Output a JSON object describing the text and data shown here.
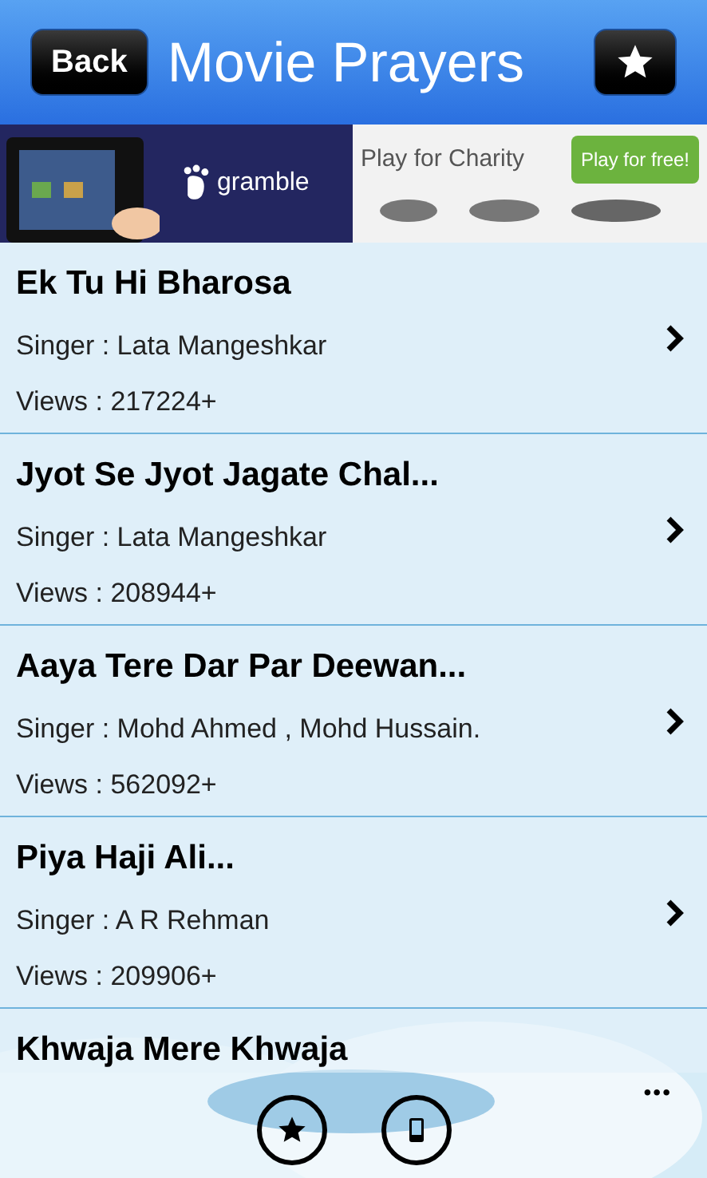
{
  "header": {
    "back_button": "Back",
    "title": "Movie Prayers"
  },
  "ad": {
    "brand": "gramble",
    "headline": "Play for Charity",
    "cta": "Play for free!"
  },
  "songs": [
    {
      "title": "Ek Tu Hi Bharosa",
      "singer": "Singer : Lata Mangeshkar",
      "views": "Views : 217224+"
    },
    {
      "title": "Jyot Se Jyot Jagate Chal...",
      "singer": "Singer : Lata Mangeshkar",
      "views": "Views : 208944+"
    },
    {
      "title": "Aaya Tere Dar Par Deewan...",
      "singer": "Singer : Mohd Ahmed , Mohd Hussain.",
      "views": "Views : 562092+"
    },
    {
      "title": "Piya Haji Ali...",
      "singer": "Singer : A R Rehman",
      "views": "Views : 209906+"
    },
    {
      "title": "Khwaja Mere Khwaja"
    }
  ],
  "app_bar": {
    "more": "•••"
  }
}
